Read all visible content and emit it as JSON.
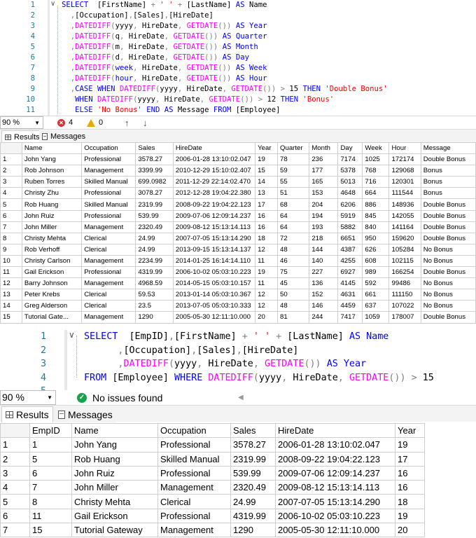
{
  "query1": {
    "lines": [
      {
        "n": "1",
        "tokens": [
          {
            "t": "SELECT  ",
            "c": "kw"
          },
          {
            "t": "[FirstName] ",
            "c": ""
          },
          {
            "t": "+ ",
            "c": "gr"
          },
          {
            "t": "' '",
            "c": "str"
          },
          {
            "t": " + ",
            "c": "gr"
          },
          {
            "t": "[LastName] ",
            "c": ""
          },
          {
            "t": "AS",
            "c": "kw"
          },
          {
            "t": " Name",
            "c": ""
          }
        ]
      },
      {
        "n": "2",
        "tokens": [
          {
            "t": "  ,",
            "c": "gr"
          },
          {
            "t": "[Occupation]",
            "c": ""
          },
          {
            "t": ",",
            "c": "gr"
          },
          {
            "t": "[Sales]",
            "c": ""
          },
          {
            "t": ",",
            "c": "gr"
          },
          {
            "t": "[HireDate]",
            "c": ""
          }
        ]
      },
      {
        "n": "3",
        "tokens": [
          {
            "t": "  ,",
            "c": "gr"
          },
          {
            "t": "DATEDIFF",
            "c": "fn"
          },
          {
            "t": "(",
            "c": "gr"
          },
          {
            "t": "yyyy",
            "c": ""
          },
          {
            "t": ", ",
            "c": "gr"
          },
          {
            "t": "HireDate",
            "c": ""
          },
          {
            "t": ", ",
            "c": "gr"
          },
          {
            "t": "GETDATE",
            "c": "fn"
          },
          {
            "t": "()) ",
            "c": "gr"
          },
          {
            "t": "AS",
            "c": "kw"
          },
          {
            "t": " Year",
            "c": "kw"
          }
        ]
      },
      {
        "n": "4",
        "tokens": [
          {
            "t": "  ,",
            "c": "gr"
          },
          {
            "t": "DATEDIFF",
            "c": "fn"
          },
          {
            "t": "(",
            "c": "gr"
          },
          {
            "t": "q",
            "c": ""
          },
          {
            "t": ", ",
            "c": "gr"
          },
          {
            "t": "HireDate",
            "c": ""
          },
          {
            "t": ", ",
            "c": "gr"
          },
          {
            "t": "GETDATE",
            "c": "fn"
          },
          {
            "t": "()) ",
            "c": "gr"
          },
          {
            "t": "AS",
            "c": "kw"
          },
          {
            "t": " Quarter",
            "c": "kw"
          }
        ]
      },
      {
        "n": "5",
        "tokens": [
          {
            "t": "  ,",
            "c": "gr"
          },
          {
            "t": "DATEDIFF",
            "c": "fn"
          },
          {
            "t": "(",
            "c": "gr"
          },
          {
            "t": "m",
            "c": ""
          },
          {
            "t": ", ",
            "c": "gr"
          },
          {
            "t": "HireDate",
            "c": ""
          },
          {
            "t": ", ",
            "c": "gr"
          },
          {
            "t": "GETDATE",
            "c": "fn"
          },
          {
            "t": "()) ",
            "c": "gr"
          },
          {
            "t": "AS",
            "c": "kw"
          },
          {
            "t": " Month",
            "c": "kw"
          }
        ]
      },
      {
        "n": "6",
        "tokens": [
          {
            "t": "  ,",
            "c": "gr"
          },
          {
            "t": "DATEDIFF",
            "c": "fn"
          },
          {
            "t": "(",
            "c": "gr"
          },
          {
            "t": "d",
            "c": ""
          },
          {
            "t": ", ",
            "c": "gr"
          },
          {
            "t": "HireDate",
            "c": ""
          },
          {
            "t": ", ",
            "c": "gr"
          },
          {
            "t": "GETDATE",
            "c": "fn"
          },
          {
            "t": "()) ",
            "c": "gr"
          },
          {
            "t": "AS",
            "c": "kw"
          },
          {
            "t": " Day",
            "c": "kw"
          }
        ]
      },
      {
        "n": "7",
        "tokens": [
          {
            "t": "  ,",
            "c": "gr"
          },
          {
            "t": "DATEDIFF",
            "c": "fn"
          },
          {
            "t": "(",
            "c": "gr"
          },
          {
            "t": "week",
            "c": "kw"
          },
          {
            "t": ", ",
            "c": "gr"
          },
          {
            "t": "HireDate",
            "c": ""
          },
          {
            "t": ", ",
            "c": "gr"
          },
          {
            "t": "GETDATE",
            "c": "fn"
          },
          {
            "t": "()) ",
            "c": "gr"
          },
          {
            "t": "AS",
            "c": "kw"
          },
          {
            "t": " Week",
            "c": "kw"
          }
        ]
      },
      {
        "n": "8",
        "tokens": [
          {
            "t": "  ,",
            "c": "gr"
          },
          {
            "t": "DATEDIFF",
            "c": "fn"
          },
          {
            "t": "(",
            "c": "gr"
          },
          {
            "t": "hour",
            "c": "kw"
          },
          {
            "t": ", ",
            "c": "gr"
          },
          {
            "t": "HireDate",
            "c": ""
          },
          {
            "t": ", ",
            "c": "gr"
          },
          {
            "t": "GETDATE",
            "c": "fn"
          },
          {
            "t": "()) ",
            "c": "gr"
          },
          {
            "t": "AS",
            "c": "kw"
          },
          {
            "t": " Hour",
            "c": "kw"
          }
        ]
      },
      {
        "n": "9",
        "tokens": [
          {
            "t": "  ,",
            "c": "gr"
          },
          {
            "t": "CASE WHEN ",
            "c": "kw"
          },
          {
            "t": "DATEDIFF",
            "c": "fn"
          },
          {
            "t": "(",
            "c": "gr"
          },
          {
            "t": "yyyy",
            "c": ""
          },
          {
            "t": ", ",
            "c": "gr"
          },
          {
            "t": "HireDate",
            "c": ""
          },
          {
            "t": ", ",
            "c": "gr"
          },
          {
            "t": "GETDATE",
            "c": "fn"
          },
          {
            "t": "()) > ",
            "c": "gr"
          },
          {
            "t": "15 ",
            "c": ""
          },
          {
            "t": "THEN ",
            "c": "kw"
          },
          {
            "t": "'Double Bonus'",
            "c": "str"
          }
        ]
      },
      {
        "n": "10",
        "tokens": [
          {
            "t": "   ",
            "c": ""
          },
          {
            "t": "WHEN ",
            "c": "kw"
          },
          {
            "t": "DATEDIFF",
            "c": "fn"
          },
          {
            "t": "(",
            "c": "gr"
          },
          {
            "t": "yyyy",
            "c": ""
          },
          {
            "t": ", ",
            "c": "gr"
          },
          {
            "t": "HireDate",
            "c": ""
          },
          {
            "t": ", ",
            "c": "gr"
          },
          {
            "t": "GETDATE",
            "c": "fn"
          },
          {
            "t": "()) > ",
            "c": "gr"
          },
          {
            "t": "12 ",
            "c": ""
          },
          {
            "t": "THEN ",
            "c": "kw"
          },
          {
            "t": "'Bonus'",
            "c": "str"
          }
        ]
      },
      {
        "n": "11",
        "tokens": [
          {
            "t": "   ",
            "c": ""
          },
          {
            "t": "ELSE ",
            "c": "kw"
          },
          {
            "t": "'No Bonus' ",
            "c": "str"
          },
          {
            "t": "END AS ",
            "c": "kw"
          },
          {
            "t": "Message ",
            "c": ""
          },
          {
            "t": "FROM ",
            "c": "kw"
          },
          {
            "t": "[Employee]",
            "c": ""
          }
        ]
      }
    ]
  },
  "status1": {
    "zoom": "90 %",
    "errors": "4",
    "warnings": "0",
    "up_arrow": "↑",
    "down_arrow": "↓"
  },
  "tabs1": {
    "results": "Results",
    "messages": "Messages"
  },
  "grid1": {
    "columns": [
      "",
      "Name",
      "Occupation",
      "Sales",
      "HireDate",
      "Year",
      "Quarter",
      "Month",
      "Day",
      "Week",
      "Hour",
      "Message"
    ],
    "rows": [
      [
        "1",
        "John Yang",
        "Professional",
        "3578.27",
        "2006-01-28 13:10:02.047",
        "19",
        "78",
        "236",
        "7174",
        "1025",
        "172174",
        "Double Bonus"
      ],
      [
        "2",
        "Rob Johnson",
        "Management",
        "3399.99",
        "2010-12-29 15:10:02.407",
        "15",
        "59",
        "177",
        "5378",
        "768",
        "129068",
        "Bonus"
      ],
      [
        "3",
        "Ruben Torres",
        "Skilled Manual",
        "699.0982",
        "2011-12-29 22:14:02.470",
        "14",
        "55",
        "165",
        "5013",
        "716",
        "120301",
        "Bonus"
      ],
      [
        "4",
        "Christy Zhu",
        "Professional",
        "3078.27",
        "2012-12-28 19:04:22.380",
        "13",
        "51",
        "153",
        "4648",
        "664",
        "111544",
        "Bonus"
      ],
      [
        "5",
        "Rob Huang",
        "Skilled Manual",
        "2319.99",
        "2008-09-22 19:04:22.123",
        "17",
        "68",
        "204",
        "6206",
        "886",
        "148936",
        "Double Bonus"
      ],
      [
        "6",
        "John Ruiz",
        "Professional",
        "539.99",
        "2009-07-06 12:09:14.237",
        "16",
        "64",
        "194",
        "5919",
        "845",
        "142055",
        "Double Bonus"
      ],
      [
        "7",
        "John Miller",
        "Management",
        "2320.49",
        "2009-08-12 15:13:14.113",
        "16",
        "64",
        "193",
        "5882",
        "840",
        "141164",
        "Double Bonus"
      ],
      [
        "8",
        "Christy Mehta",
        "Clerical",
        "24.99",
        "2007-07-05 15:13:14.290",
        "18",
        "72",
        "218",
        "6651",
        "950",
        "159620",
        "Double Bonus"
      ],
      [
        "9",
        "Rob Verhoff",
        "Clerical",
        "24.99",
        "2013-09-15 15:13:14.137",
        "12",
        "48",
        "144",
        "4387",
        "626",
        "105284",
        "No Bonus"
      ],
      [
        "10",
        "Christy Carlson",
        "Management",
        "2234.99",
        "2014-01-25 16:14:14.110",
        "11",
        "46",
        "140",
        "4255",
        "608",
        "102115",
        "No Bonus"
      ],
      [
        "11",
        "Gail Erickson",
        "Professional",
        "4319.99",
        "2006-10-02 05:03:10.223",
        "19",
        "75",
        "227",
        "6927",
        "989",
        "166254",
        "Double Bonus"
      ],
      [
        "12",
        "Barry Johnson",
        "Management",
        "4968.59",
        "2014-05-15 05:03:10.157",
        "11",
        "45",
        "136",
        "4145",
        "592",
        "99486",
        "No Bonus"
      ],
      [
        "13",
        "Peter Krebs",
        "Clerical",
        "59.53",
        "2013-01-14 05:03:10.367",
        "12",
        "50",
        "152",
        "4631",
        "661",
        "111150",
        "No Bonus"
      ],
      [
        "14",
        "Greg Alderson",
        "Clerical",
        "23.5",
        "2013-07-05 05:03:10.333",
        "12",
        "48",
        "146",
        "4459",
        "637",
        "107022",
        "No Bonus"
      ],
      [
        "15",
        "Tutorial Gate...",
        "Management",
        "1290",
        "2005-05-30 12:11:10.000",
        "20",
        "81",
        "244",
        "7417",
        "1059",
        "178007",
        "Double Bonus"
      ]
    ]
  },
  "query2": {
    "lines": [
      {
        "n": "1",
        "tokens": [
          {
            "t": "SELECT  ",
            "c": "kw"
          },
          {
            "t": "[EmpID]",
            "c": ""
          },
          {
            "t": ",",
            "c": "gr"
          },
          {
            "t": "[FirstName] ",
            "c": ""
          },
          {
            "t": "+ ",
            "c": "gr"
          },
          {
            "t": "' '",
            "c": "str"
          },
          {
            "t": " + ",
            "c": "gr"
          },
          {
            "t": "[LastName] ",
            "c": ""
          },
          {
            "t": "AS",
            "c": "kw"
          },
          {
            "t": " Name",
            "c": "kw"
          }
        ]
      },
      {
        "n": "2",
        "tokens": [
          {
            "t": "      ,",
            "c": "gr"
          },
          {
            "t": "[Occupation]",
            "c": ""
          },
          {
            "t": ",",
            "c": "gr"
          },
          {
            "t": "[Sales]",
            "c": ""
          },
          {
            "t": ",",
            "c": "gr"
          },
          {
            "t": "[HireDate]",
            "c": ""
          }
        ]
      },
      {
        "n": "3",
        "tokens": [
          {
            "t": "      ,",
            "c": "gr"
          },
          {
            "t": "DATEDIFF",
            "c": "fn"
          },
          {
            "t": "(",
            "c": "gr"
          },
          {
            "t": "yyyy",
            "c": ""
          },
          {
            "t": ", ",
            "c": "gr"
          },
          {
            "t": "HireDate",
            "c": ""
          },
          {
            "t": ", ",
            "c": "gr"
          },
          {
            "t": "GETDATE",
            "c": "fn"
          },
          {
            "t": "()) ",
            "c": "gr"
          },
          {
            "t": "AS",
            "c": "kw"
          },
          {
            "t": " Year",
            "c": "kw"
          }
        ]
      },
      {
        "n": "4",
        "tokens": [
          {
            "t": "FROM ",
            "c": "kw"
          },
          {
            "t": "[Employee] ",
            "c": ""
          },
          {
            "t": "WHERE ",
            "c": "kw"
          },
          {
            "t": "DATEDIFF",
            "c": "fn"
          },
          {
            "t": "(",
            "c": "gr"
          },
          {
            "t": "yyyy",
            "c": ""
          },
          {
            "t": ", ",
            "c": "gr"
          },
          {
            "t": "HireDate",
            "c": ""
          },
          {
            "t": ", ",
            "c": "gr"
          },
          {
            "t": "GETDATE",
            "c": "fn"
          },
          {
            "t": "()) > ",
            "c": "gr"
          },
          {
            "t": "15",
            "c": ""
          }
        ]
      },
      {
        "n": "5",
        "tokens": []
      }
    ]
  },
  "status2": {
    "zoom": "90 %",
    "status_text": "No issues found",
    "scroll_left": "◀"
  },
  "tabs2": {
    "results": "Results",
    "messages": "Messages"
  },
  "grid2": {
    "columns": [
      "",
      "EmpID",
      "Name",
      "Occupation",
      "Sales",
      "HireDate",
      "Year"
    ],
    "rows": [
      [
        "1",
        "1",
        "John Yang",
        "Professional",
        "3578.27",
        "2006-01-28 13:10:02.047",
        "19"
      ],
      [
        "2",
        "5",
        "Rob Huang",
        "Skilled Manual",
        "2319.99",
        "2008-09-22 19:04:22.123",
        "17"
      ],
      [
        "3",
        "6",
        "John Ruiz",
        "Professional",
        "539.99",
        "2009-07-06 12:09:14.237",
        "16"
      ],
      [
        "4",
        "7",
        "John Miller",
        "Management",
        "2320.49",
        "2009-08-12 15:13:14.113",
        "16"
      ],
      [
        "5",
        "8",
        "Christy Mehta",
        "Clerical",
        "24.99",
        "2007-07-05 15:13:14.290",
        "18"
      ],
      [
        "6",
        "11",
        "Gail Erickson",
        "Professional",
        "4319.99",
        "2006-10-02 05:03:10.223",
        "19"
      ],
      [
        "7",
        "15",
        "Tutorial Gateway",
        "Management",
        "1290",
        "2005-05-30 12:11:10.000",
        "20"
      ]
    ]
  },
  "colors": {
    "keyword": "#0000ff",
    "function": "#ff00ff",
    "string": "#ff0000",
    "operator": "#808080",
    "line_number": "#237893"
  }
}
